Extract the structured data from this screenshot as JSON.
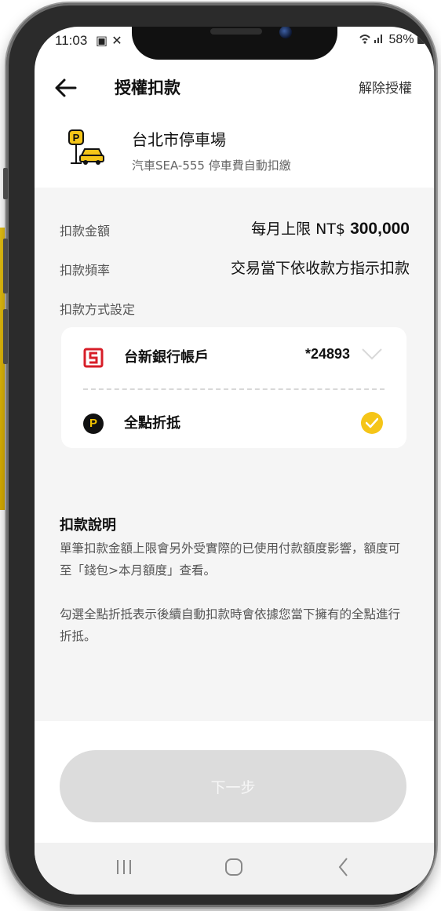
{
  "status_bar": {
    "time": "11:03",
    "left_icons": "▣ ✕",
    "right": "58%"
  },
  "header": {
    "title": "授權扣款",
    "revoke_label": "解除授權"
  },
  "merchant": {
    "name": "台北市停車場",
    "description": "汽車SEA-555 停車費自動扣繳"
  },
  "details": {
    "amount_label": "扣款金額",
    "amount_prefix": "每月上限 NT$",
    "amount_value": "300,000",
    "frequency_label": "扣款頻率",
    "frequency_value": "交易當下依收款方指示扣款",
    "method_label": "扣款方式設定"
  },
  "payment_methods": {
    "bank_name": "台新銀行帳戶",
    "bank_account": "*24893",
    "points_name": "全點折抵",
    "points_logo_letter": "P"
  },
  "notes": {
    "title": "扣款說明",
    "paragraph1": "單筆扣款金額上限會另外受實際的已使用付款額度影響，額度可至「錢包>本月額度」查看。",
    "paragraph2": "勾選全點折抵表示後續自動扣款時會依據您當下擁有的全點進行折抵。"
  },
  "next_button_label": "下一步",
  "colors": {
    "accent": "#f5c518",
    "bank_red": "#d71e28",
    "button_disabled": "#dcdcdc"
  }
}
